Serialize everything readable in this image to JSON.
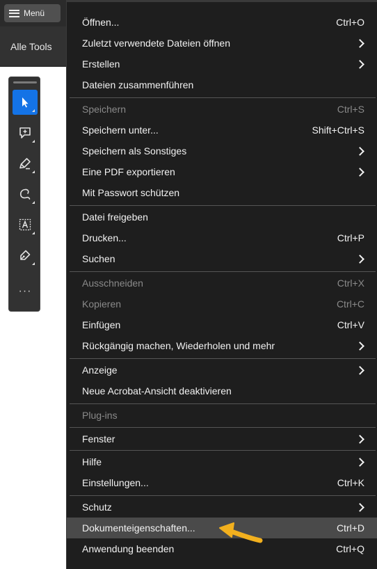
{
  "topbar": {
    "menu_label": "Menü"
  },
  "tools_header": {
    "label": "Alle Tools"
  },
  "toolbar": {
    "tools": [
      {
        "name": "select-tool",
        "icon": "pointer-icon",
        "active": true
      },
      {
        "name": "comment-tool",
        "icon": "comment-add-icon",
        "active": false
      },
      {
        "name": "highlight-tool",
        "icon": "highlighter-icon",
        "active": false
      },
      {
        "name": "draw-tool",
        "icon": "freehand-icon",
        "active": false
      },
      {
        "name": "text-tool",
        "icon": "text-box-icon",
        "active": false
      },
      {
        "name": "sign-tool",
        "icon": "pen-sign-icon",
        "active": false
      }
    ],
    "more_label": "···"
  },
  "menu": {
    "items": [
      {
        "label": "Öffnen...",
        "shortcut": "Ctrl+O",
        "submenu": false,
        "disabled": false
      },
      {
        "label": "Zuletzt verwendete Dateien öffnen",
        "shortcut": "",
        "submenu": true,
        "disabled": false
      },
      {
        "label": "Erstellen",
        "shortcut": "",
        "submenu": true,
        "disabled": false
      },
      {
        "label": "Dateien zusammenführen",
        "shortcut": "",
        "submenu": false,
        "disabled": false
      },
      {
        "label": "Speichern",
        "shortcut": "Ctrl+S",
        "submenu": false,
        "disabled": true
      },
      {
        "label": "Speichern unter...",
        "shortcut": "Shift+Ctrl+S",
        "submenu": false,
        "disabled": false
      },
      {
        "label": "Speichern als Sonstiges",
        "shortcut": "",
        "submenu": true,
        "disabled": false
      },
      {
        "label": "Eine PDF exportieren",
        "shortcut": "",
        "submenu": true,
        "disabled": false
      },
      {
        "label": "Mit Passwort schützen",
        "shortcut": "",
        "submenu": false,
        "disabled": false
      },
      {
        "label": "Datei freigeben",
        "shortcut": "",
        "submenu": false,
        "disabled": false
      },
      {
        "label": "Drucken...",
        "shortcut": "Ctrl+P",
        "submenu": false,
        "disabled": false
      },
      {
        "label": "Suchen",
        "shortcut": "",
        "submenu": true,
        "disabled": false
      },
      {
        "label": "Ausschneiden",
        "shortcut": "Ctrl+X",
        "submenu": false,
        "disabled": true
      },
      {
        "label": "Kopieren",
        "shortcut": "Ctrl+C",
        "submenu": false,
        "disabled": true
      },
      {
        "label": "Einfügen",
        "shortcut": "Ctrl+V",
        "submenu": false,
        "disabled": false
      },
      {
        "label": "Rückgängig machen, Wiederholen und mehr",
        "shortcut": "",
        "submenu": true,
        "disabled": false
      },
      {
        "label": "Anzeige",
        "shortcut": "",
        "submenu": true,
        "disabled": false
      },
      {
        "label": "Neue Acrobat-Ansicht deaktivieren",
        "shortcut": "",
        "submenu": false,
        "disabled": false
      },
      {
        "label": "Plug-ins",
        "shortcut": "",
        "submenu": false,
        "disabled": true
      },
      {
        "label": "Fenster",
        "shortcut": "",
        "submenu": true,
        "disabled": false
      },
      {
        "label": "Hilfe",
        "shortcut": "",
        "submenu": true,
        "disabled": false
      },
      {
        "label": "Einstellungen...",
        "shortcut": "Ctrl+K",
        "submenu": false,
        "disabled": false
      },
      {
        "label": "Schutz",
        "shortcut": "",
        "submenu": true,
        "disabled": false
      },
      {
        "label": "Dokumenteigenschaften...",
        "shortcut": "Ctrl+D",
        "submenu": false,
        "disabled": false,
        "highlighted": true
      },
      {
        "label": "Anwendung beenden",
        "shortcut": "Ctrl+Q",
        "submenu": false,
        "disabled": false
      }
    ]
  },
  "colors": {
    "menu_bg": "#1e1e1e",
    "highlight_bg": "#4a4a4a",
    "active_tool": "#1473e6",
    "annotation_arrow": "#f2b01e",
    "disabled_text": "#8a8a8a"
  }
}
